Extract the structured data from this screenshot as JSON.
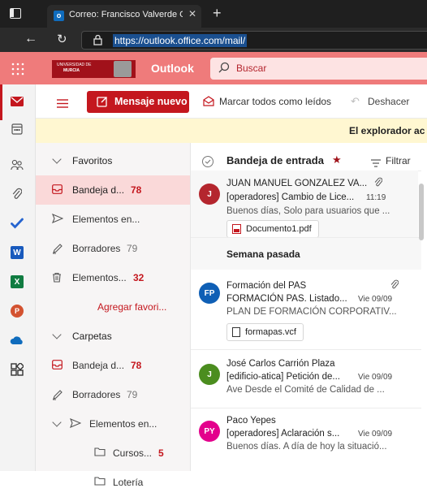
{
  "browser": {
    "tab_title": "Correo: Francisco Valverde Galar",
    "url": "https://outlook.office.com/mail/"
  },
  "header": {
    "university_logo_line1": "UNIVERSIDAD DE",
    "university_logo_line2": "MURCIA",
    "app_name": "Outlook",
    "search_placeholder": "Buscar"
  },
  "toolbar": {
    "new_mail": "Mensaje nuevo",
    "mark_all_read": "Marcar todos como leídos",
    "undo": "Deshacer"
  },
  "notification": {
    "text": "El explorador ac"
  },
  "folders": {
    "favorites_heading": "Favoritos",
    "favorites": [
      {
        "label": "Bandeja d...",
        "count": "78",
        "icon": "inbox-icon",
        "style": "red",
        "selected": true
      },
      {
        "label": "Elementos en...",
        "count": "",
        "icon": "send-icon",
        "style": "none",
        "selected": false
      },
      {
        "label": "Borradores",
        "count": "79",
        "icon": "pencil-icon",
        "style": "gray",
        "selected": false
      },
      {
        "label": "Elementos...",
        "count": "32",
        "icon": "trash-icon",
        "style": "red",
        "selected": false
      }
    ],
    "add_favorite": "Agregar favori...",
    "folders_heading": "Carpetas",
    "folders": [
      {
        "label": "Bandeja d...",
        "count": "78",
        "icon": "inbox-icon",
        "style": "red"
      },
      {
        "label": "Borradores",
        "count": "79",
        "icon": "pencil-icon",
        "style": "gray"
      },
      {
        "label": "Elementos en...",
        "count": "",
        "icon": "send-icon",
        "style": "none"
      }
    ],
    "subfolders": [
      {
        "label": "Cursos...",
        "count": "5",
        "icon": "folder-icon",
        "style": "red"
      },
      {
        "label": "Lotería",
        "count": "",
        "icon": "folder-icon",
        "style": "none"
      }
    ]
  },
  "message_list": {
    "title": "Bandeja de entrada",
    "filter": "Filtrar",
    "section_last_week": "Semana pasada",
    "messages": [
      {
        "initials": "J",
        "avatar_color": "#b4262e",
        "sender": "JUAN MANUEL GONZALEZ VA...",
        "subject": "[operadores] Cambio de Lice...",
        "date": "11:19",
        "preview": "Buenos días, Solo para usuarios que ...",
        "attachment": "Documento1.pdf",
        "attachment_icon": "pdf-file-icon"
      },
      {
        "initials": "FP",
        "avatar_color": "#0f5fb5",
        "sender": "Formación del PAS",
        "subject": "FORMACIÓN PAS. Listado...",
        "date": "Vie 09/09",
        "preview": "PLAN DE FORMACIÓN CORPORATIV...",
        "attachment": "formapas.vcf",
        "attachment_icon": "file-icon"
      },
      {
        "initials": "J",
        "avatar_color": "#4b8d1f",
        "sender": "José Carlos Carrión Plaza",
        "subject": "[edificio-atica] Petición de...",
        "date": "Vie 09/09",
        "preview": "Ave Desde el Comité de Calidad de ..."
      },
      {
        "initials": "PY",
        "avatar_color": "#e3008c",
        "sender": "Paco Yepes",
        "subject": "[operadores] Aclaración s...",
        "date": "Vie 09/09",
        "preview": "Buenos días. A día de hoy la situació..."
      }
    ]
  },
  "colors": {
    "brand_red": "#c4171e",
    "header_bg": "#ef7b7b",
    "selected_folder_bg": "#fad9d9"
  }
}
